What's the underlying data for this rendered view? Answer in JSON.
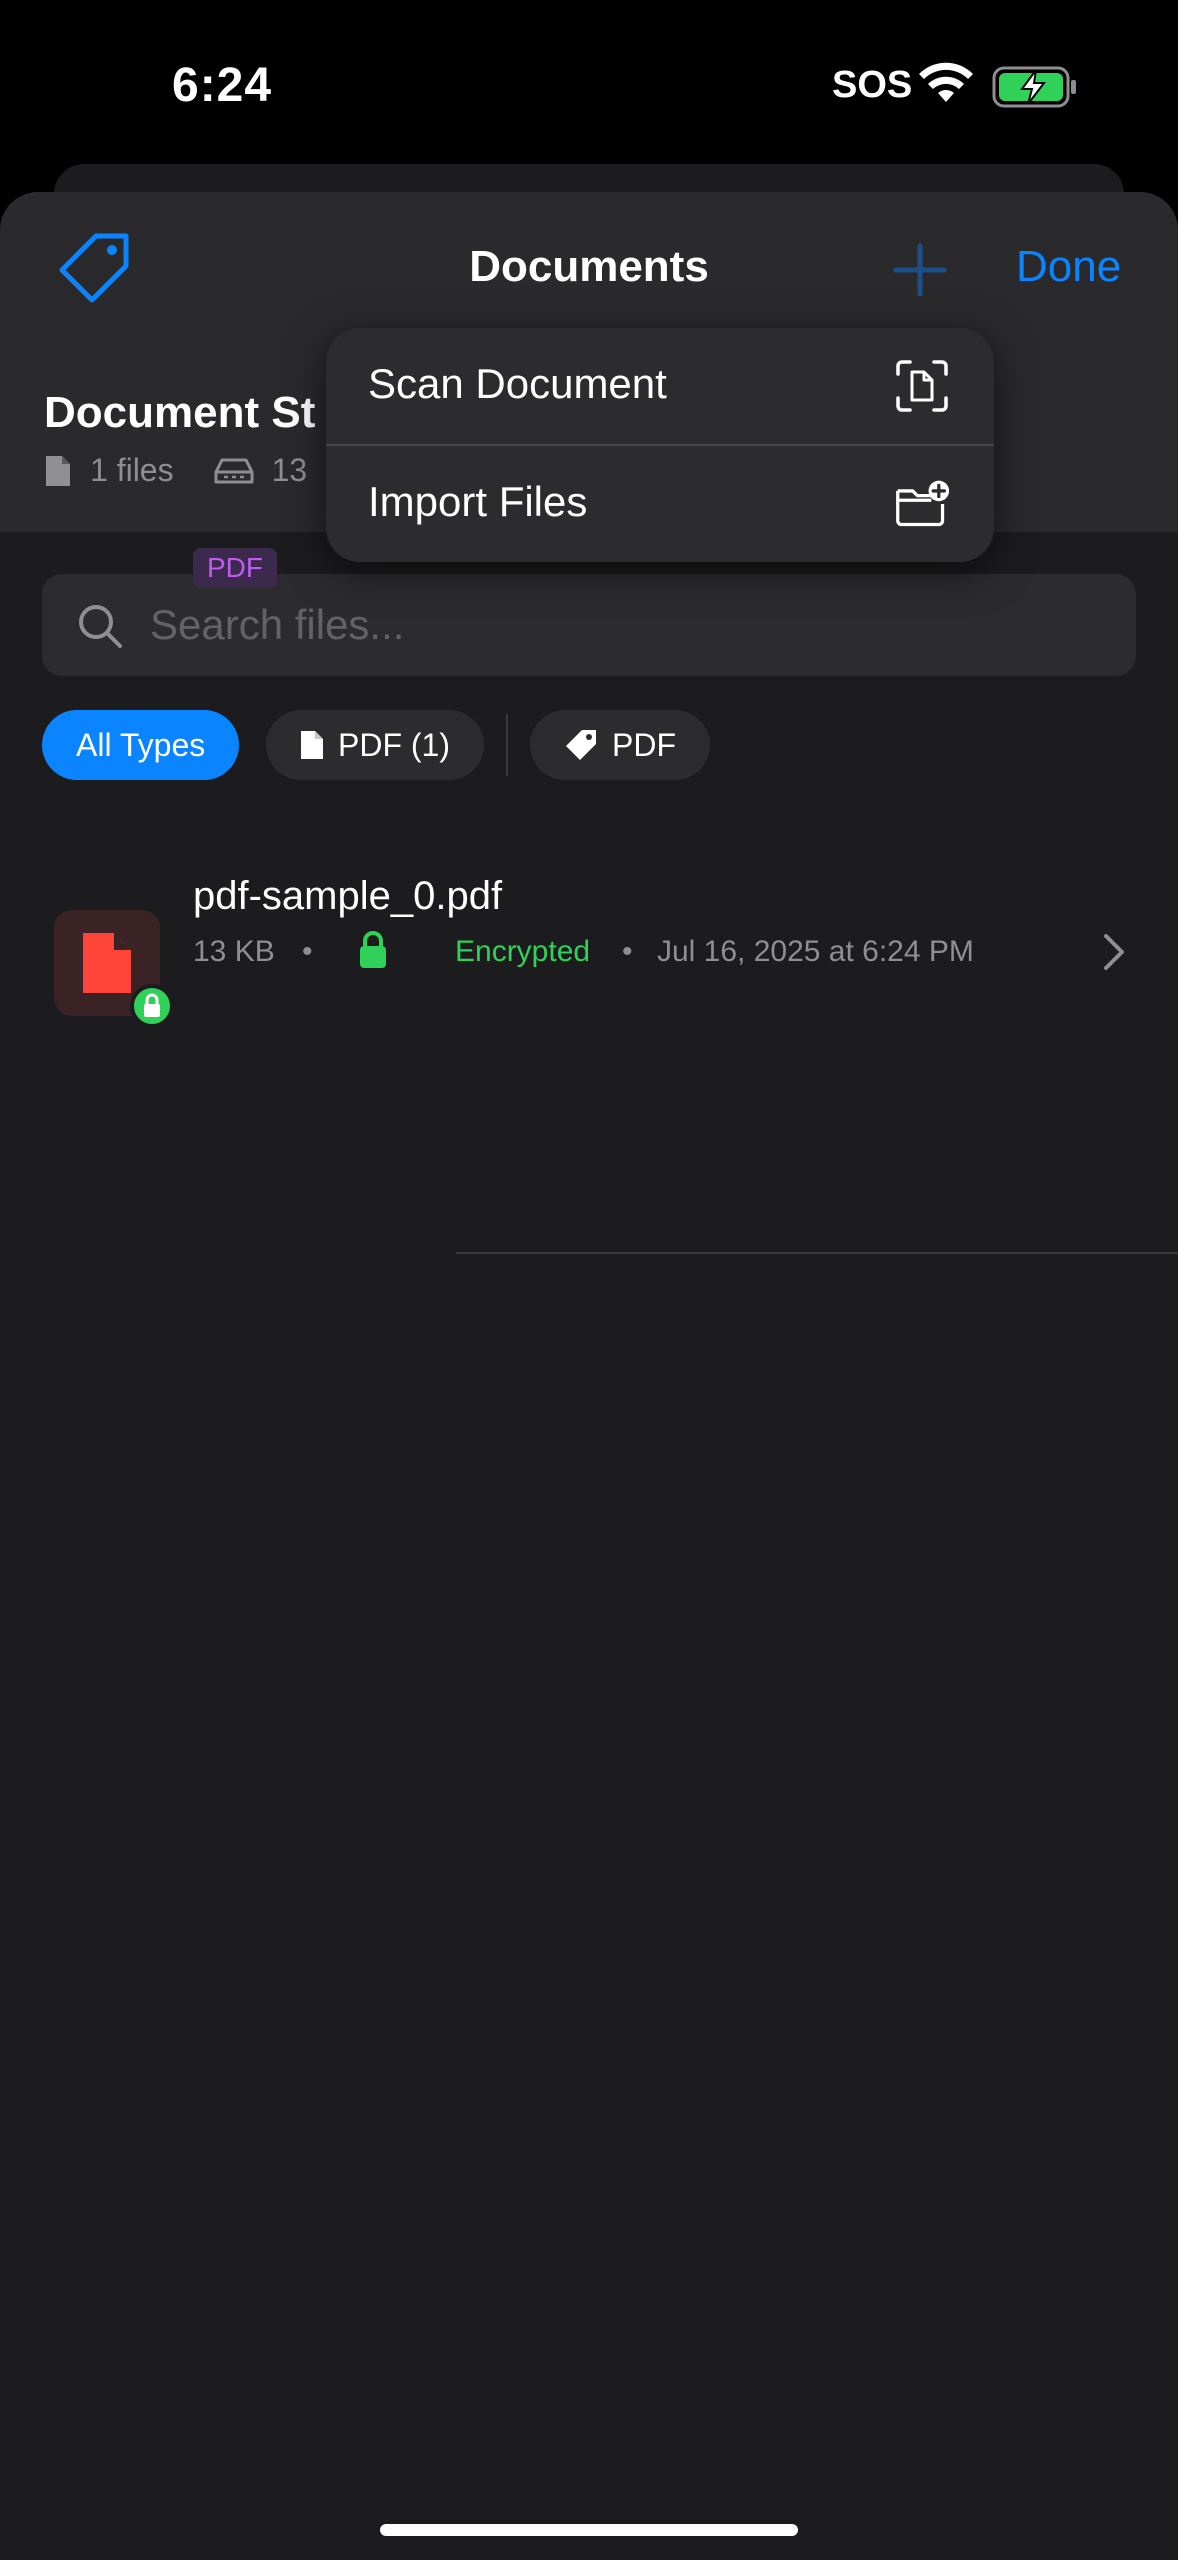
{
  "status_bar": {
    "time": "6:24",
    "sos": "SOS"
  },
  "nav": {
    "title": "Documents",
    "done_label": "Done"
  },
  "storage": {
    "title": "Document St",
    "files_count": "1 files",
    "size_partial": "13"
  },
  "search": {
    "placeholder": "Search files..."
  },
  "filters": {
    "all_types": "All Types",
    "pdf_count": "PDF (1)",
    "tag_pdf": "PDF"
  },
  "file": {
    "name": "pdf-sample_0.pdf",
    "size": "13 KB",
    "separator": "•",
    "status": "Encrypted",
    "date": "Jul 16, 2025 at 6:24 PM",
    "tag": "PDF"
  },
  "menu": {
    "scan_label": "Scan Document",
    "import_label": "Import Files"
  },
  "colors": {
    "accent": "#0a84ff",
    "encrypted": "#30d158",
    "pdf_red": "#ff453a",
    "tag_purple": "#bf5af2"
  }
}
